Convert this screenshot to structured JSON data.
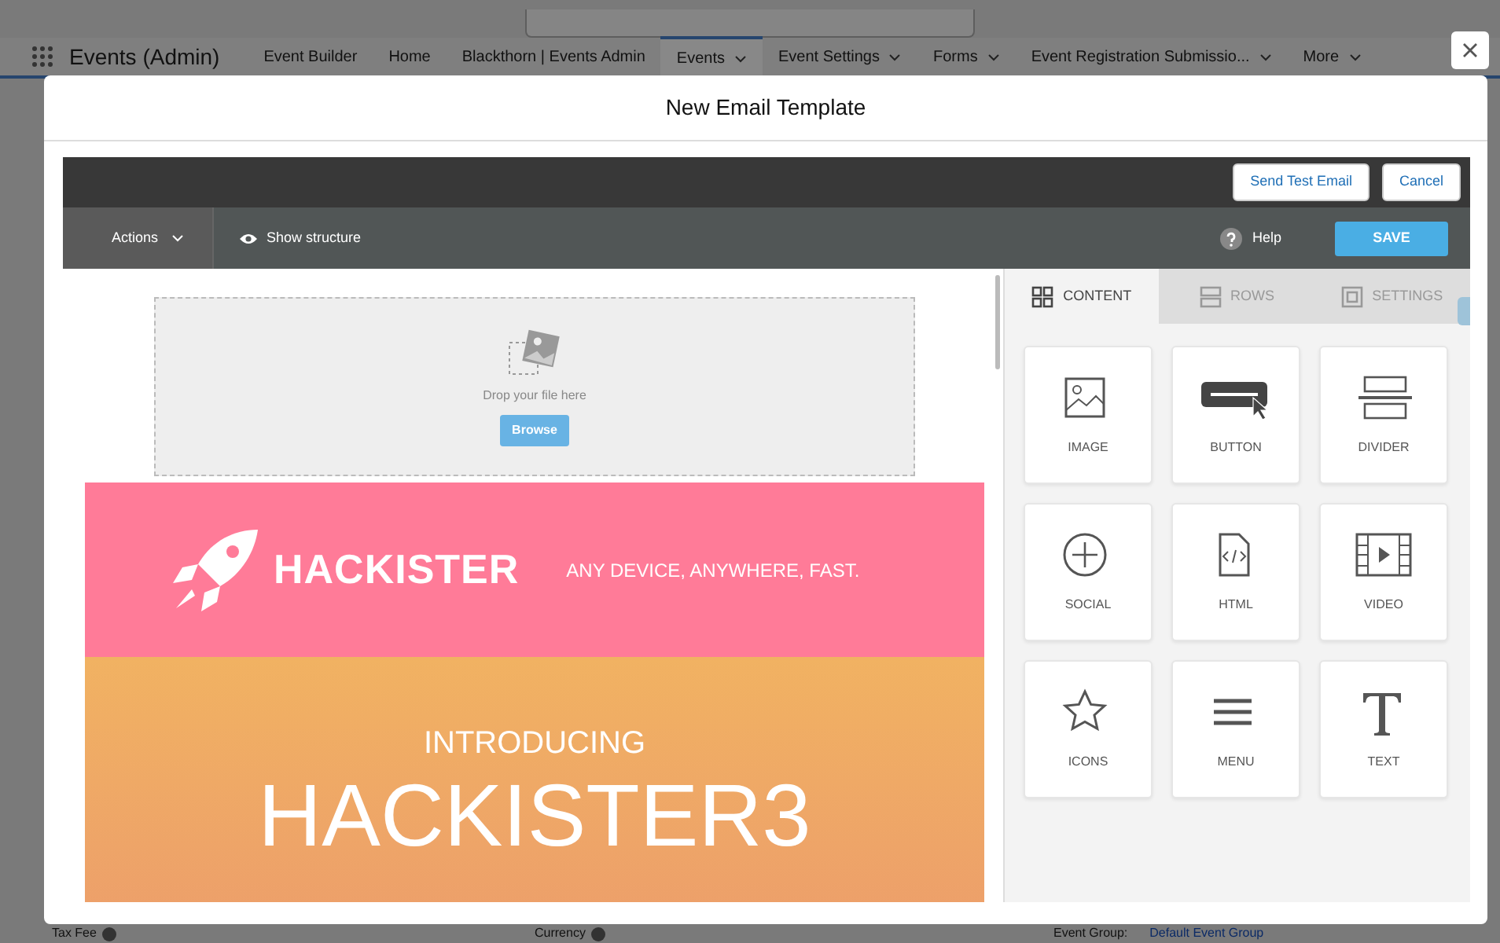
{
  "background_page": {
    "app_name": "Events (Admin)",
    "nav_items": [
      {
        "label": "Event Builder",
        "dropdown": false,
        "selected": false
      },
      {
        "label": "Home",
        "dropdown": false,
        "selected": false
      },
      {
        "label": "Blackthorn | Events Admin",
        "dropdown": false,
        "selected": false
      },
      {
        "label": "Events",
        "dropdown": true,
        "selected": true
      },
      {
        "label": "Event Settings",
        "dropdown": true,
        "selected": false
      },
      {
        "label": "Forms",
        "dropdown": true,
        "selected": false
      },
      {
        "label": "Event Registration Submissio...",
        "dropdown": true,
        "selected": false
      },
      {
        "label": "More",
        "dropdown": true,
        "selected": false
      }
    ],
    "footer_fields": [
      {
        "label": "Tax Fee"
      },
      {
        "label": "Currency"
      }
    ],
    "event_group": {
      "label": "Event Group:",
      "value": "Default Event Group"
    }
  },
  "modal": {
    "title": "New Email Template",
    "top_buttons": [
      {
        "label": "Send Test Email"
      },
      {
        "label": "Cancel"
      }
    ],
    "toolbar": {
      "actions": "Actions",
      "show_structure": "Show structure",
      "help": "Help",
      "save": "SAVE"
    },
    "drop_zone": {
      "text": "Drop your file here",
      "button": "Browse"
    },
    "banner": {
      "logo_text": "HACKISTER",
      "tagline": "ANY DEVICE, ANYWHERE, FAST."
    },
    "hero": {
      "kicker": "INTRODUCING",
      "headline": "HACKISTER3"
    },
    "panel_tabs": [
      {
        "label": "CONTENT",
        "kind": "grid",
        "selected": true
      },
      {
        "label": "ROWS",
        "kind": "rows",
        "selected": false
      },
      {
        "label": "SETTINGS",
        "kind": "settings",
        "selected": false
      }
    ],
    "blocks": [
      {
        "label": "IMAGE",
        "kind": "image"
      },
      {
        "label": "BUTTON",
        "kind": "button"
      },
      {
        "label": "DIVIDER",
        "kind": "divider"
      },
      {
        "label": "SOCIAL",
        "kind": "social"
      },
      {
        "label": "HTML",
        "kind": "html"
      },
      {
        "label": "VIDEO",
        "kind": "video"
      },
      {
        "label": "ICONS",
        "kind": "icons"
      },
      {
        "label": "MENU",
        "kind": "menu"
      },
      {
        "label": "TEXT",
        "kind": "text"
      }
    ]
  }
}
